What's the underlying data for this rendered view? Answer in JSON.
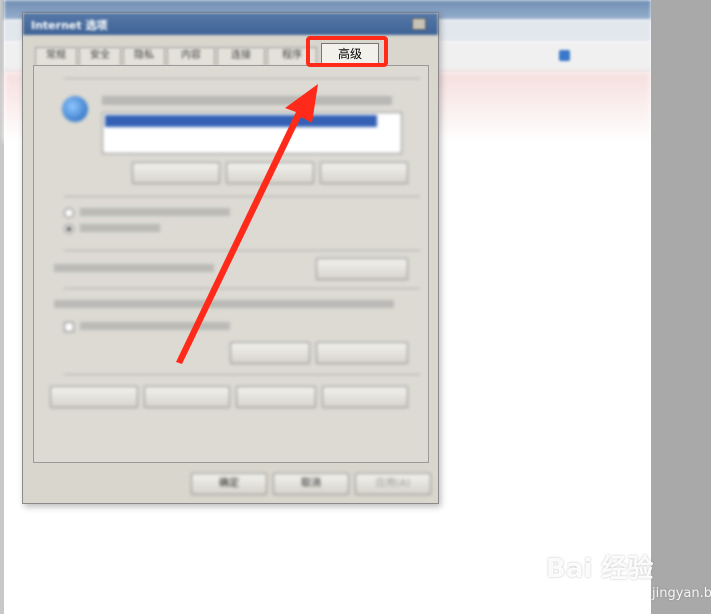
{
  "background_window": {
    "title": "",
    "favorites_items": [
      "",
      ""
    ]
  },
  "dialog": {
    "title": "Internet 选项",
    "tabs": [
      "常规",
      "安全",
      "隐私",
      "内容",
      "连接",
      "程序",
      "高级"
    ],
    "active_tab": "高级",
    "highlighted_tab": "高级",
    "sections": {
      "homepage": "",
      "startup": "",
      "tabs": "",
      "history": "",
      "appearance": ""
    },
    "buttons": {
      "ok": "确定",
      "cancel": "取消",
      "apply": "应用(A)"
    }
  },
  "annotation": {
    "highlight_color": "#ff2a1a",
    "arrow_color": "#ff2a1a"
  },
  "watermark": {
    "main": "Bai 经验",
    "sub": "jingyan.baidu.com"
  }
}
